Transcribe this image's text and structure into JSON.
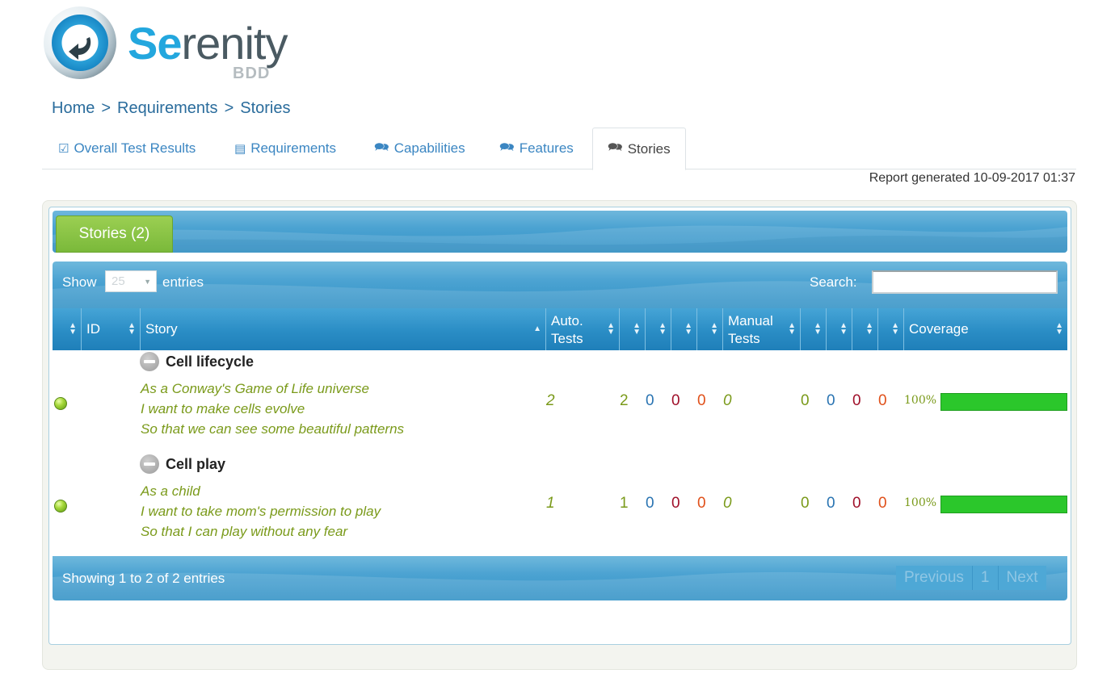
{
  "brand": {
    "word_accent": "Se",
    "word_rest": "renity",
    "sub": "BDD"
  },
  "breadcrumb": {
    "home": "Home",
    "requirements": "Requirements",
    "stories": "Stories",
    "separator": ">"
  },
  "tabs": [
    {
      "label": "Overall Test Results",
      "icon": "check-square-icon"
    },
    {
      "label": "Requirements",
      "icon": "book-icon"
    },
    {
      "label": "Capabilities",
      "icon": "comments-icon"
    },
    {
      "label": "Features",
      "icon": "comments-icon"
    },
    {
      "label": "Stories",
      "icon": "comments-icon",
      "active": true
    }
  ],
  "report_generated": "Report generated 10-09-2017 01:37",
  "panel": {
    "title": "Stories (2)"
  },
  "table": {
    "show_label": "Show",
    "entries_value": "25",
    "entries_label": "entries",
    "search_label": "Search:",
    "search_value": "",
    "headers": {
      "id": "ID",
      "story": "Story",
      "auto_line1": "Auto.",
      "auto_line2": "Tests",
      "manual_line1": "Manual",
      "manual_line2": "Tests",
      "coverage": "Coverage"
    },
    "rows": [
      {
        "title": "Cell lifecycle",
        "narrative": [
          "As a Conway's Game of Life universe",
          "I want to make cells evolve",
          "So that we can see some beautiful patterns"
        ],
        "auto_tests": "2",
        "auto_pass": "2",
        "auto_skip": "0",
        "auto_fail": "0",
        "auto_error": "0",
        "manual_tests": "0",
        "manual_pass": "0",
        "manual_skip": "0",
        "manual_fail": "0",
        "manual_error": "0",
        "coverage_label": "100%",
        "coverage": 1.0
      },
      {
        "title": "Cell play",
        "narrative": [
          "As a child",
          "I want to take mom's permission to play",
          "So that I can play without any fear"
        ],
        "auto_tests": "1",
        "auto_pass": "1",
        "auto_skip": "0",
        "auto_fail": "0",
        "auto_error": "0",
        "manual_tests": "0",
        "manual_pass": "0",
        "manual_skip": "0",
        "manual_fail": "0",
        "manual_error": "0",
        "coverage_label": "100%",
        "coverage": 1.0
      }
    ],
    "showing": "Showing 1 to 2 of 2 entries",
    "pager": {
      "previous": "Previous",
      "page": "1",
      "next": "Next"
    }
  },
  "colors": {
    "accent": "#23a7de",
    "pass": "#7a9a1a",
    "skip": "#2a74b2",
    "fail": "#a0102a",
    "error": "#e0501a",
    "coverage": "#2bc72b"
  }
}
